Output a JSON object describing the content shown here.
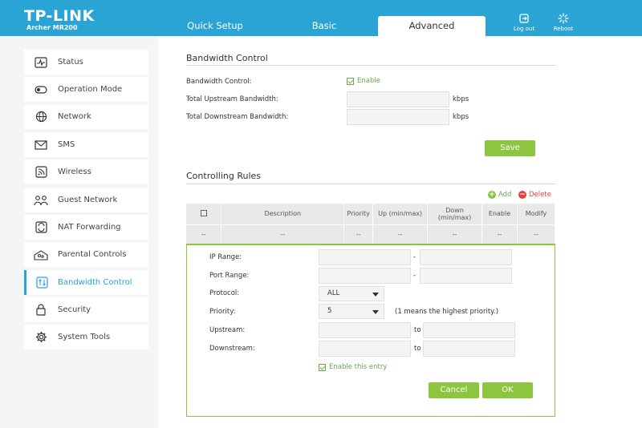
{
  "header": {
    "logo": "TP-LINK",
    "model": "Archer MR200",
    "tabs": [
      {
        "label": "Quick Setup"
      },
      {
        "label": "Basic"
      },
      {
        "label": "Advanced"
      }
    ],
    "logout_label": "Log out",
    "reboot_label": "Reboot"
  },
  "sidebar": {
    "items": [
      {
        "label": "Status",
        "icon": "status-icon"
      },
      {
        "label": "Operation Mode",
        "icon": "operation-mode-icon"
      },
      {
        "label": "Network",
        "icon": "globe-icon"
      },
      {
        "label": "SMS",
        "icon": "envelope-icon"
      },
      {
        "label": "Wireless",
        "icon": "wireless-icon"
      },
      {
        "label": "Guest Network",
        "icon": "guest-icon"
      },
      {
        "label": "NAT Forwarding",
        "icon": "nat-icon"
      },
      {
        "label": "Parental Controls",
        "icon": "parental-icon"
      },
      {
        "label": "Bandwidth Control",
        "icon": "bandwidth-icon"
      },
      {
        "label": "Security",
        "icon": "lock-icon"
      },
      {
        "label": "System Tools",
        "icon": "gear-icon"
      }
    ],
    "active_index": 8
  },
  "bandwidth": {
    "title": "Bandwidth Control",
    "control_label": "Bandwidth Control:",
    "enable_label": "Enable",
    "upstream_label": "Total Upstream Bandwidth:",
    "downstream_label": "Total Downstream Bandwidth:",
    "unit": "kbps",
    "upstream_value": "",
    "downstream_value": "",
    "save_label": "Save"
  },
  "rules": {
    "title": "Controlling Rules",
    "add_label": "Add",
    "delete_label": "Delete",
    "columns": [
      "Description",
      "Priority",
      "Up (min/max)",
      "Down (min/max)",
      "Enable",
      "Modify"
    ],
    "row": [
      "--",
      "--",
      "--",
      "--",
      "--",
      "--",
      "--"
    ]
  },
  "editor": {
    "ip_range_label": "IP Range:",
    "port_range_label": "Port Range:",
    "protocol_label": "Protocol:",
    "priority_label": "Priority:",
    "upstream_label": "Upstream:",
    "downstream_label": "Downstream:",
    "dash": "-",
    "to": "to",
    "protocol_value": "ALL",
    "priority_value": "5",
    "priority_hint": "(1 means the highest priority.)",
    "enable_entry_label": "Enable this entry",
    "cancel_label": "Cancel",
    "ok_label": "OK"
  },
  "colors": {
    "header": "#2aa3d5",
    "accent_green": "#8cc63f",
    "delete_red": "#e0463c"
  }
}
